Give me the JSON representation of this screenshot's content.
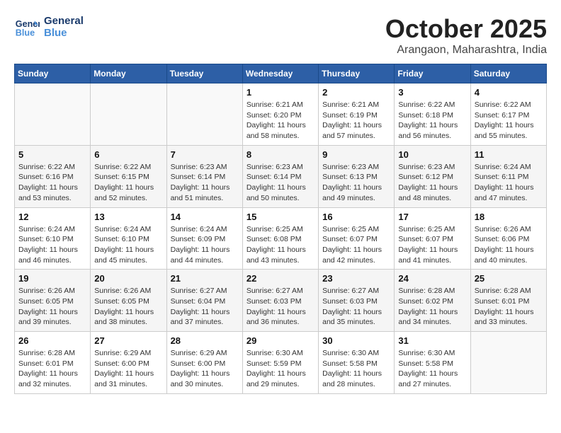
{
  "header": {
    "logo_line1": "General",
    "logo_line2": "Blue",
    "month_title": "October 2025",
    "location": "Arangaon, Maharashtra, India"
  },
  "weekdays": [
    "Sunday",
    "Monday",
    "Tuesday",
    "Wednesday",
    "Thursday",
    "Friday",
    "Saturday"
  ],
  "weeks": [
    [
      {
        "day": "",
        "info": ""
      },
      {
        "day": "",
        "info": ""
      },
      {
        "day": "",
        "info": ""
      },
      {
        "day": "1",
        "info": "Sunrise: 6:21 AM\nSunset: 6:20 PM\nDaylight: 11 hours\nand 58 minutes."
      },
      {
        "day": "2",
        "info": "Sunrise: 6:21 AM\nSunset: 6:19 PM\nDaylight: 11 hours\nand 57 minutes."
      },
      {
        "day": "3",
        "info": "Sunrise: 6:22 AM\nSunset: 6:18 PM\nDaylight: 11 hours\nand 56 minutes."
      },
      {
        "day": "4",
        "info": "Sunrise: 6:22 AM\nSunset: 6:17 PM\nDaylight: 11 hours\nand 55 minutes."
      }
    ],
    [
      {
        "day": "5",
        "info": "Sunrise: 6:22 AM\nSunset: 6:16 PM\nDaylight: 11 hours\nand 53 minutes."
      },
      {
        "day": "6",
        "info": "Sunrise: 6:22 AM\nSunset: 6:15 PM\nDaylight: 11 hours\nand 52 minutes."
      },
      {
        "day": "7",
        "info": "Sunrise: 6:23 AM\nSunset: 6:14 PM\nDaylight: 11 hours\nand 51 minutes."
      },
      {
        "day": "8",
        "info": "Sunrise: 6:23 AM\nSunset: 6:14 PM\nDaylight: 11 hours\nand 50 minutes."
      },
      {
        "day": "9",
        "info": "Sunrise: 6:23 AM\nSunset: 6:13 PM\nDaylight: 11 hours\nand 49 minutes."
      },
      {
        "day": "10",
        "info": "Sunrise: 6:23 AM\nSunset: 6:12 PM\nDaylight: 11 hours\nand 48 minutes."
      },
      {
        "day": "11",
        "info": "Sunrise: 6:24 AM\nSunset: 6:11 PM\nDaylight: 11 hours\nand 47 minutes."
      }
    ],
    [
      {
        "day": "12",
        "info": "Sunrise: 6:24 AM\nSunset: 6:10 PM\nDaylight: 11 hours\nand 46 minutes."
      },
      {
        "day": "13",
        "info": "Sunrise: 6:24 AM\nSunset: 6:10 PM\nDaylight: 11 hours\nand 45 minutes."
      },
      {
        "day": "14",
        "info": "Sunrise: 6:24 AM\nSunset: 6:09 PM\nDaylight: 11 hours\nand 44 minutes."
      },
      {
        "day": "15",
        "info": "Sunrise: 6:25 AM\nSunset: 6:08 PM\nDaylight: 11 hours\nand 43 minutes."
      },
      {
        "day": "16",
        "info": "Sunrise: 6:25 AM\nSunset: 6:07 PM\nDaylight: 11 hours\nand 42 minutes."
      },
      {
        "day": "17",
        "info": "Sunrise: 6:25 AM\nSunset: 6:07 PM\nDaylight: 11 hours\nand 41 minutes."
      },
      {
        "day": "18",
        "info": "Sunrise: 6:26 AM\nSunset: 6:06 PM\nDaylight: 11 hours\nand 40 minutes."
      }
    ],
    [
      {
        "day": "19",
        "info": "Sunrise: 6:26 AM\nSunset: 6:05 PM\nDaylight: 11 hours\nand 39 minutes."
      },
      {
        "day": "20",
        "info": "Sunrise: 6:26 AM\nSunset: 6:05 PM\nDaylight: 11 hours\nand 38 minutes."
      },
      {
        "day": "21",
        "info": "Sunrise: 6:27 AM\nSunset: 6:04 PM\nDaylight: 11 hours\nand 37 minutes."
      },
      {
        "day": "22",
        "info": "Sunrise: 6:27 AM\nSunset: 6:03 PM\nDaylight: 11 hours\nand 36 minutes."
      },
      {
        "day": "23",
        "info": "Sunrise: 6:27 AM\nSunset: 6:03 PM\nDaylight: 11 hours\nand 35 minutes."
      },
      {
        "day": "24",
        "info": "Sunrise: 6:28 AM\nSunset: 6:02 PM\nDaylight: 11 hours\nand 34 minutes."
      },
      {
        "day": "25",
        "info": "Sunrise: 6:28 AM\nSunset: 6:01 PM\nDaylight: 11 hours\nand 33 minutes."
      }
    ],
    [
      {
        "day": "26",
        "info": "Sunrise: 6:28 AM\nSunset: 6:01 PM\nDaylight: 11 hours\nand 32 minutes."
      },
      {
        "day": "27",
        "info": "Sunrise: 6:29 AM\nSunset: 6:00 PM\nDaylight: 11 hours\nand 31 minutes."
      },
      {
        "day": "28",
        "info": "Sunrise: 6:29 AM\nSunset: 6:00 PM\nDaylight: 11 hours\nand 30 minutes."
      },
      {
        "day": "29",
        "info": "Sunrise: 6:30 AM\nSunset: 5:59 PM\nDaylight: 11 hours\nand 29 minutes."
      },
      {
        "day": "30",
        "info": "Sunrise: 6:30 AM\nSunset: 5:58 PM\nDaylight: 11 hours\nand 28 minutes."
      },
      {
        "day": "31",
        "info": "Sunrise: 6:30 AM\nSunset: 5:58 PM\nDaylight: 11 hours\nand 27 minutes."
      },
      {
        "day": "",
        "info": ""
      }
    ]
  ]
}
